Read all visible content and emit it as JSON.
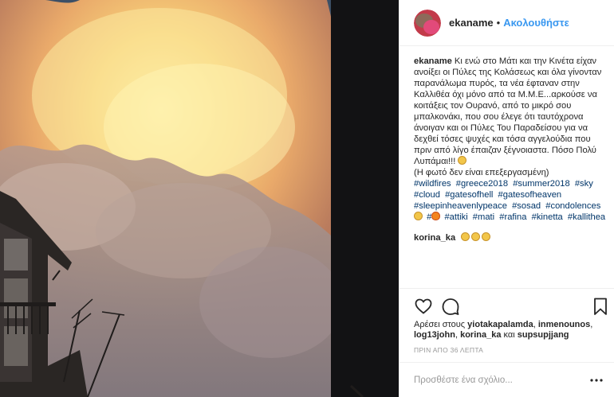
{
  "post": {
    "username": "ekaname",
    "follow_label": "Ακολουθήστε",
    "separator": "•",
    "image_description_icon": "photo-of-sunset-clouds",
    "caption": {
      "username": "ekaname",
      "text": "Κι ενώ στο Μάτι και την Κινέτα είχαν ανοίξει οι Πύλες της Κολάσεως και όλα γίνονταν παρανάλωμα πυρός, τα νέα έφταναν στην Καλλιθέα όχι μόνο από τα Μ.Μ.Ε...αρκούσε να κοιτάξεις τον Ουρανό, από το μικρό σου μπαλκονάκι, που σου έλεγε ότι ταυτόχρονα άνοιγαν και οι Πύλες Του Παραδείσου για να δεχθεί τόσες ψυχές και τόσα αγγελούδια που πριν από λίγο έπαιζαν ξέγνοιαστα. Πόσο Πολύ Λυπάμαι!!! ",
      "note": "(Η φωτό δεν είναι επεξεργασμένη)",
      "hashtags": [
        "#wildfires",
        "#greece2018",
        "#summer2018",
        "#sky",
        "#cloud",
        "#gatesofhell",
        "#gatesofheaven",
        "#sleepinheavenlypeace",
        "#sosad",
        "#condolences",
        "#attiki",
        "#mati",
        "#rafina",
        "#kinetta",
        "#kallithea"
      ],
      "emoji_sad": "sad-face-emoji",
      "emoji_fire": "fire-emoji"
    },
    "comments": [
      {
        "username": "korina_ka",
        "text": ""
      }
    ],
    "likes": {
      "prefix": "Αρέσει στους",
      "users": [
        "yiotakapalamda",
        "inmenounos",
        "log13john",
        "korina_ka"
      ],
      "connector": "και",
      "last_user": "supsupjjang"
    },
    "timestamp": "ΠΡΙΝ ΑΠΟ 36 ΛΕΠΤΑ",
    "add_comment_placeholder": "Προσθέστε ένα σχόλιο...",
    "colors": {
      "follow": "#3897f0",
      "hashtag": "#003569",
      "border": "#efefef",
      "muted": "#999999"
    }
  }
}
